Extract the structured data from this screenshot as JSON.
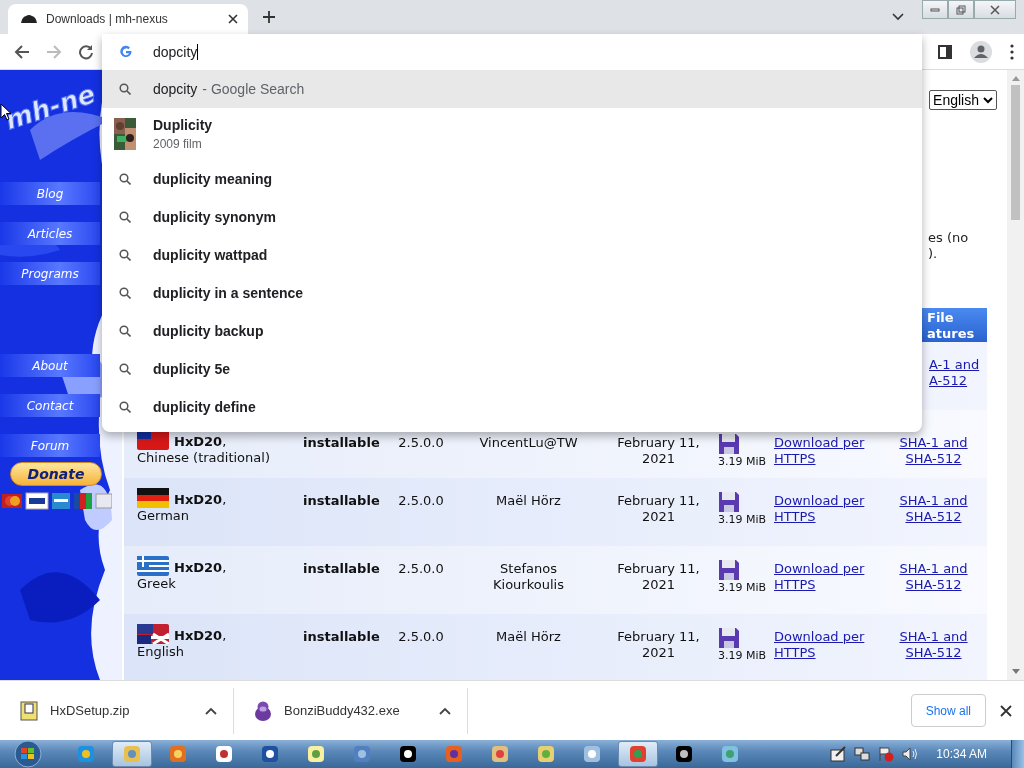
{
  "browser": {
    "tab": {
      "title": "Downloads | mh-nexus",
      "selected": true
    },
    "nav": {
      "forward_disabled": true
    },
    "omnibox": {
      "value": "dopcity"
    },
    "suggestions": [
      {
        "kind": "search",
        "text": "dopcity",
        "suffix": "- Google Search",
        "typed": true,
        "selected": true
      },
      {
        "kind": "entity",
        "text": "Duplicity",
        "subtitle": "2009 film",
        "selected": false
      },
      {
        "kind": "search",
        "text": "duplicity meaning",
        "typed": false,
        "selected": false
      },
      {
        "kind": "search",
        "text": "duplicity synonym",
        "typed": false,
        "selected": false
      },
      {
        "kind": "search",
        "text": "duplicity wattpad",
        "typed": false,
        "selected": false
      },
      {
        "kind": "search",
        "text": "duplicity in a sentence",
        "typed": false,
        "selected": false
      },
      {
        "kind": "search",
        "text": "duplicity backup",
        "typed": false,
        "selected": false
      },
      {
        "kind": "search",
        "text": "duplicity 5e",
        "typed": false,
        "selected": false
      },
      {
        "kind": "search",
        "text": "duplicity define",
        "typed": false,
        "selected": false
      }
    ]
  },
  "sidebar": {
    "logo": "mh-ne",
    "items": [
      {
        "label": "Blog"
      },
      {
        "label": "Articles"
      },
      {
        "label": "Programs"
      },
      {
        "label": "About"
      },
      {
        "label": "Contact"
      },
      {
        "label": "Forum"
      }
    ],
    "donate": "Donate"
  },
  "language": {
    "value": "English"
  },
  "intro": {
    "line_1": "es (no",
    "line_2": ")."
  },
  "table": {
    "header": {
      "line_1": "File",
      "line_2": "atures"
    },
    "partial_row": {
      "sha_lines": [
        "A-1 and",
        "A-512"
      ]
    },
    "rows": [
      {
        "kind": "tw",
        "name": "**HxD20**,",
        "language": "Chinese (traditional)",
        "type": "installable",
        "version": "2.5.0.0",
        "author": "VincentLu@TW",
        "date": "February 11, 2021",
        "size": "3.19 MiB",
        "link": "Download per HTTPS",
        "sha": "SHA-1 and SHA-512"
      },
      {
        "kind": "de",
        "name": "**HxD20**,",
        "language": "German",
        "type": "installable",
        "version": "2.5.0.0",
        "author": "Maël Hörz",
        "date": "February 11, 2021",
        "size": "3.19 MiB",
        "link": "Download per HTTPS",
        "sha": "SHA-1 and SHA-512"
      },
      {
        "kind": "gr",
        "name": "**HxD20**,",
        "language": "Greek",
        "type": "installable",
        "version": "2.5.0.0",
        "author": "Stefanos Kiourkoulis",
        "date": "February 11, 2021",
        "size": "3.19 MiB",
        "link": "Download per HTTPS",
        "sha": "SHA-1 and SHA-512"
      },
      {
        "kind": "en",
        "name": "**HxD20**,",
        "language": "English",
        "type": "installable",
        "version": "2.5.0.0",
        "author": "Maël Hörz",
        "date": "February 11, 2021",
        "size": "3.19 MiB",
        "link": "Download per HTTPS",
        "sha": "SHA-1 and SHA-512"
      }
    ]
  },
  "downloads": {
    "items": [
      {
        "name": "HxDSetup.zip",
        "kind": "zip"
      },
      {
        "name": "BonziBuddy432.exe",
        "kind": "exe"
      }
    ],
    "show_all": "Show all"
  },
  "taskbar": {
    "items": [
      {
        "kind": "ie",
        "selected": false
      },
      {
        "kind": "explorer",
        "selected": true
      },
      {
        "kind": "media",
        "selected": false
      },
      {
        "kind": "cards",
        "selected": false
      },
      {
        "kind": "shell",
        "selected": false
      },
      {
        "kind": "notepad",
        "selected": false
      },
      {
        "kind": "network",
        "selected": false
      },
      {
        "kind": "archive",
        "selected": false
      },
      {
        "kind": "firefox",
        "selected": false
      },
      {
        "kind": "paint",
        "selected": false
      },
      {
        "kind": "folders",
        "selected": false
      },
      {
        "kind": "calculator",
        "selected": false
      },
      {
        "kind": "chrome",
        "selected": true
      },
      {
        "kind": "console",
        "selected": false
      },
      {
        "kind": "usb",
        "selected": false
      }
    ],
    "clock": "10:34 AM"
  }
}
